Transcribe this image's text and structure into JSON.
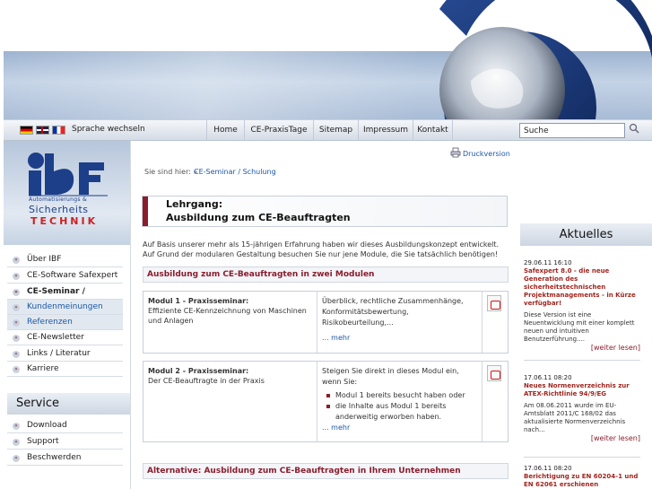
{
  "nav": {
    "language_label": "Sprache wechseln",
    "items": [
      "Home",
      "CE-PraxisTage",
      "Sitemap",
      "Impressum",
      "Kontakt"
    ],
    "search_value": "Suche"
  },
  "logo": {
    "line1": "Automatisierungs &",
    "line2": "Sicherheits",
    "line3": "TECHNIK"
  },
  "sidebar": {
    "items": [
      {
        "label": "Über IBF"
      },
      {
        "label": "CE-Software Safexpert"
      },
      {
        "label": "CE-Seminar / Schulung"
      },
      {
        "label": "Kundenmeinungen"
      },
      {
        "label": "Referenzen"
      },
      {
        "label": "CE-Newsletter"
      },
      {
        "label": "Links / Literatur"
      },
      {
        "label": "Karriere"
      }
    ],
    "service_title": "Service",
    "service_items": [
      {
        "label": "Download"
      },
      {
        "label": "Support"
      },
      {
        "label": "Beschwerden"
      }
    ]
  },
  "main": {
    "print_label": "Druckversion",
    "breadcrumb_label": "Sie sind hier: »",
    "breadcrumb_link": "CE-Seminar / Schulung",
    "headline1": "Lehrgang:",
    "headline2": "Ausbildung zum CE-Beauftragten",
    "intro": "Auf Basis unserer mehr als 15-jährigen Erfahrung haben wir dieses Ausbildungskonzept entwickelt. Auf Grund der modularen Gestaltung besuchen Sie nur jene Module, die Sie tatsächlich benötigen!",
    "section1": "Ausbildung zum CE-Beauftragten in zwei Modulen",
    "modules": [
      {
        "title": "Modul 1 - Praxisseminar:",
        "desc": "Effiziente CE-Kennzeichnung von Maschinen und Anlagen",
        "summary": "Überblick, rechtliche Zusammenhänge, Konformitätsbewertung, Risikobeurteilung,...",
        "more": "... mehr"
      },
      {
        "title": "Modul 2 - Praxisseminar:",
        "desc": "Der CE-Beauftragte in der Praxis",
        "summary": "Steigen Sie direkt in dieses Modul ein, wenn Sie:",
        "bullets": [
          "Modul 1 bereits besucht haben oder",
          "die Inhalte aus Modul 1 bereits anderweitig erworben haben."
        ],
        "more": "... mehr"
      }
    ],
    "section2": "Alternative: Ausbildung zum CE-Beauftragten in Ihrem Unternehmen"
  },
  "news": {
    "title": "Aktuelles",
    "items": [
      {
        "date": "29.06.11 16:10",
        "title": "Safexpert 8.0 - die neue Generation des sicherheitstechnischen Projektmanagements - in Kürze verfügbar!",
        "text": "Diese Version ist eine Neuentwicklung mit einer komplett neuen und intuitiven Benutzerführung....",
        "more": "[weiter lesen]"
      },
      {
        "date": "17.06.11 08:20",
        "title": "Neues Normenverzeichnis zur ATEX-Richtlinie 94/9/EG",
        "text": "Am 08.06.2011 wurde im EU-Amtsblatt 2011/C 168/02 das aktualisierte Normenverzeichnis nach...",
        "more": "[weiter lesen]"
      },
      {
        "date": "17.06.11 08:20",
        "title": "Berichtigung zu EN 60204-1 und EN 62061 erschienen",
        "text": "",
        "more": ""
      }
    ]
  },
  "colors": {
    "accent": "#8a1d2d",
    "link": "#1c58a8",
    "logo_blue": "#1d3f8a"
  }
}
